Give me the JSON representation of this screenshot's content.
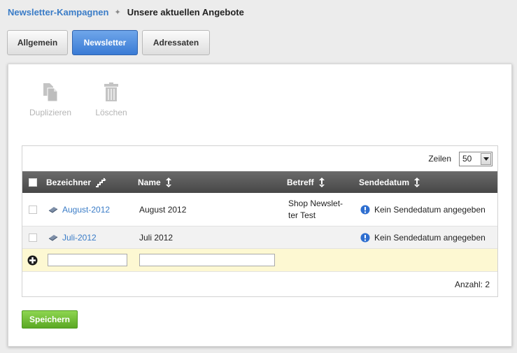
{
  "breadcrumb": {
    "parent": "Newsletter-Kampagnen",
    "current": "Unsere aktuellen Angebote"
  },
  "tabs": [
    {
      "label": "Allgemein",
      "active": false
    },
    {
      "label": "Newsletter",
      "active": true
    },
    {
      "label": "Adressaten",
      "active": false
    }
  ],
  "toolbar": {
    "duplicate_label": "Duplizieren",
    "delete_label": "Löschen"
  },
  "grid": {
    "rows_per_page_label": "Zeilen",
    "rows_per_page_value": "50",
    "columns": {
      "bezeichner": "Bezeichner",
      "name": "Name",
      "betreff": "Betreff",
      "sendedatum": "Sendedatum"
    },
    "rows": [
      {
        "bezeichner": "August-2012",
        "name": "August 2012",
        "betreff_line1": "Shop Newslet-",
        "betreff_line2": "ter Test",
        "sendedatum": "Kein Sendedatum angegeben"
      },
      {
        "bezeichner": "Juli-2012",
        "name": "Juli 2012",
        "betreff_line1": "",
        "betreff_line2": "",
        "sendedatum": "Kein Sendedatum angegeben"
      }
    ],
    "count_label": "Anzahl: 2"
  },
  "save_label": "Speichern",
  "colors": {
    "accent": "#3a7cc7",
    "active_tab": "#4a8be0",
    "header": "#565656",
    "new_row": "#fdf8d2",
    "save": "#6bb82f"
  }
}
